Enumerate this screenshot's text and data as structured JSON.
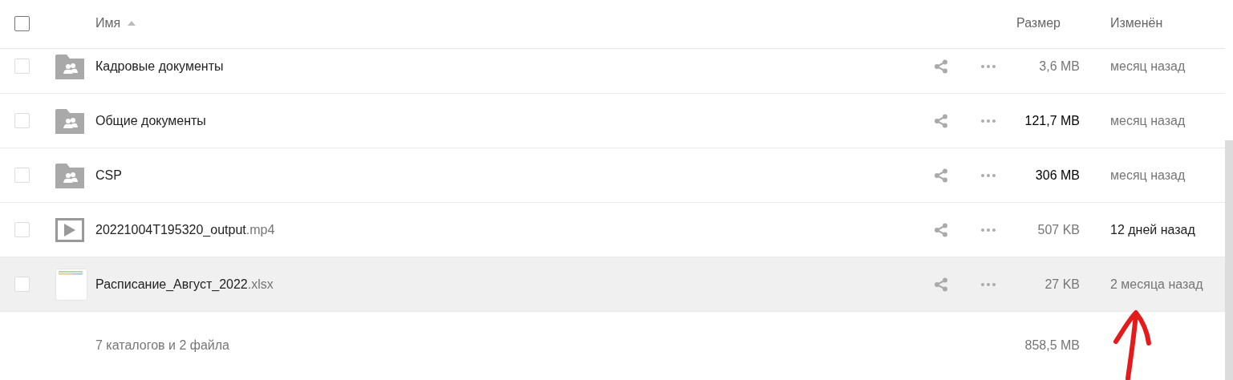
{
  "header": {
    "select_all": {
      "checked": false
    },
    "columns": [
      {
        "label": "Имя",
        "sorted": true
      },
      {
        "label": "Размер",
        "sorted": false
      },
      {
        "label": "Изменён",
        "sorted": false
      }
    ]
  },
  "rows": [
    {
      "kind": "shared-folder",
      "name": "Кадровые документы",
      "size": "3,6 MB",
      "large": false,
      "modified": "месяц назад",
      "recent": false,
      "highlighted": false,
      "checked": false
    },
    {
      "kind": "shared-folder",
      "name": "Общие документы",
      "size": "121,7 MB",
      "large": true,
      "modified": "месяц назад",
      "recent": false,
      "highlighted": false,
      "checked": false
    },
    {
      "kind": "shared-folder",
      "name": "CSP",
      "size": "306 MB",
      "large": true,
      "modified": "месяц назад",
      "recent": false,
      "highlighted": false,
      "checked": false
    },
    {
      "kind": "video",
      "name": "20221004T195320_output",
      "ext": ".mp4",
      "size": "507 KB",
      "large": false,
      "modified": "12 дней назад",
      "recent": true,
      "highlighted": false,
      "checked": false
    },
    {
      "kind": "spreadsheet",
      "name": "Расписание_Август_2022",
      "ext": ".xlsx",
      "size": "27 KB",
      "large": false,
      "modified": "2 месяца назад",
      "recent": false,
      "highlighted": true,
      "checked": false
    }
  ],
  "summary": {
    "counts": "7 каталогов и 2 файла",
    "total_size": "858,5 MB"
  }
}
